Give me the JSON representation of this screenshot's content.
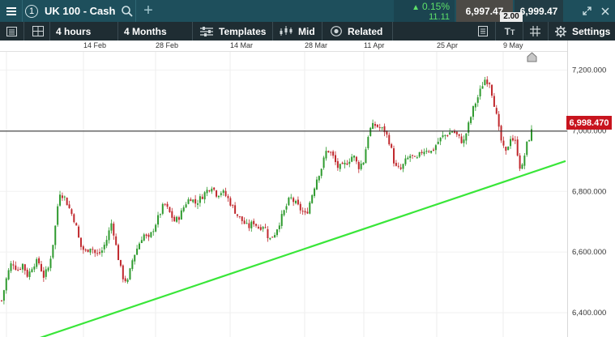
{
  "topbar": {
    "tab_number": "1",
    "instrument": "UK 100 - Cash",
    "change_percent": "0.15%",
    "change_points": "11.11",
    "sell_price": "6,997.47",
    "buy_price": "6,999.47",
    "spread": "2.00",
    "colors": {
      "background": "#1e4f5c",
      "positive": "#5ee06a",
      "sell_bg": "#4c4a46",
      "buy_bg": "#223c45"
    }
  },
  "toolbar": {
    "timeframe": "4 hours",
    "range": "4 Months",
    "templates_label": "Templates",
    "price_type_label": "Mid",
    "related_label": "Related",
    "settings_label": "Settings",
    "icons": [
      "menu-icon",
      "layout-icon",
      "templates-icon",
      "candles-icon",
      "related-icon",
      "sheet-icon",
      "text-size-icon",
      "grid-icon",
      "gear-icon"
    ]
  },
  "chart_data": {
    "type": "candlestick",
    "instrument": "UK 100 - Cash",
    "date_ticks": [
      "14 Feb",
      "28 Feb",
      "14 Mar",
      "28 Mar",
      "11 Apr",
      "25 Apr",
      "9 May"
    ],
    "price_ticks": [
      "7,200.000",
      "7,000.000",
      "6,800.000",
      "6,600.000",
      "6,400.000"
    ],
    "price_tick_values": [
      7200,
      7000,
      6800,
      6600,
      6400
    ],
    "current_price": 6998.47,
    "current_price_label": "6,998.470",
    "ylim": [
      6320,
      7260
    ],
    "trendline": {
      "color": "#39e639",
      "from": 6280,
      "to": 6900
    },
    "candle_up_color": "#2e9a2e",
    "candle_down_color": "#c0282d",
    "close_path": [
      6440,
      6520,
      6570,
      6540,
      6560,
      6520,
      6560,
      6570,
      6520,
      6550,
      6650,
      6800,
      6780,
      6740,
      6700,
      6620,
      6600,
      6620,
      6590,
      6600,
      6640,
      6700,
      6600,
      6520,
      6500,
      6580,
      6620,
      6660,
      6640,
      6680,
      6720,
      6760,
      6730,
      6700,
      6720,
      6760,
      6780,
      6760,
      6780,
      6800,
      6820,
      6790,
      6800,
      6780,
      6750,
      6720,
      6700,
      6680,
      6700,
      6680,
      6690,
      6640,
      6660,
      6700,
      6740,
      6780,
      6760,
      6740,
      6720,
      6780,
      6840,
      6880,
      6940,
      6920,
      6880,
      6880,
      6900,
      6920,
      6880,
      6900,
      7000,
      7020,
      7010,
      7000,
      6960,
      6880,
      6870,
      6900,
      6920,
      6900,
      6930,
      6940,
      6930,
      6960,
      6980,
      6990,
      7000,
      6980,
      6960,
      7020,
      7080,
      7120,
      7170,
      7160,
      7080,
      6980,
      6920,
      6980,
      6960,
      6860,
      6950,
      6998
    ]
  }
}
